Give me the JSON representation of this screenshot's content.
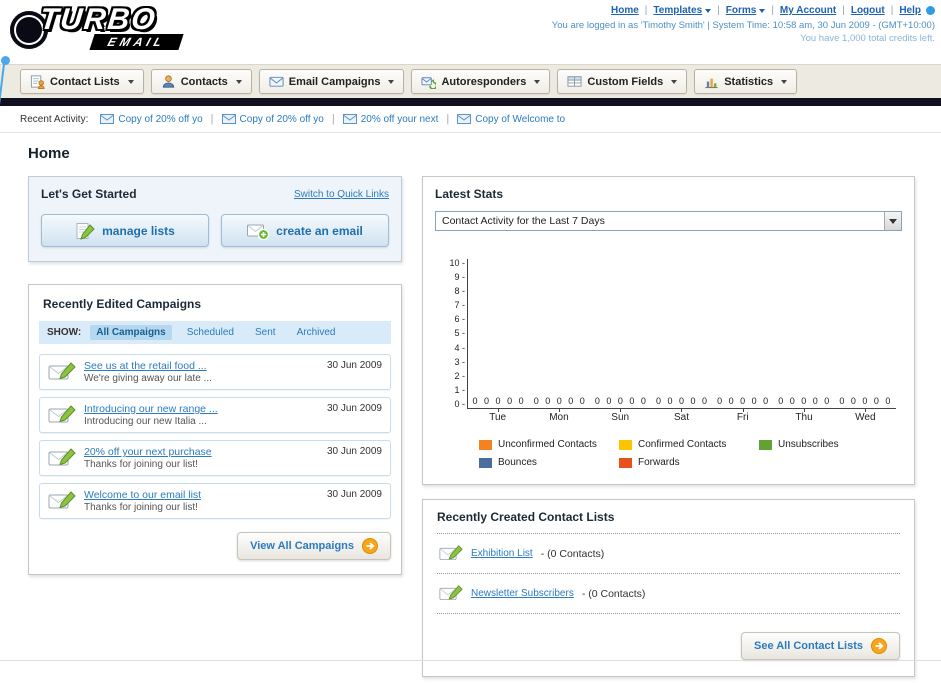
{
  "header": {
    "logo_title": "TURBO",
    "logo_subtitle": "EMAIL",
    "nav": {
      "home": "Home",
      "templates": "Templates",
      "forms": "Forms",
      "my_account": "My Account",
      "logout": "Logout",
      "help": "Help"
    },
    "login_info": "You are logged in as 'Timothy Smith' | System Time: 10:58 am, 30 Jun 2009 - (GMT+10:00)",
    "credits_info": "You have 1,000 total credits left."
  },
  "nav_tabs": [
    {
      "label": "Contact Lists"
    },
    {
      "label": "Contacts"
    },
    {
      "label": "Email Campaigns"
    },
    {
      "label": "Autoresponders"
    },
    {
      "label": "Custom Fields"
    },
    {
      "label": "Statistics"
    }
  ],
  "recent_activity": {
    "label": "Recent Activity:",
    "items": [
      {
        "text": "Copy of 20% off yo"
      },
      {
        "text": "Copy of 20% off yo"
      },
      {
        "text": "20% off your next"
      },
      {
        "text": "Copy of Welcome to"
      }
    ]
  },
  "page": {
    "title": "Home"
  },
  "get_started": {
    "title": "Let's Get Started",
    "switch_link": "Switch to Quick Links",
    "manage_lists_button": "manage lists",
    "create_email_button": "create an email"
  },
  "campaigns": {
    "title": "Recently Edited Campaigns",
    "show_label": "SHOW:",
    "tabs": [
      {
        "label": "All Campaigns"
      },
      {
        "label": "Scheduled"
      },
      {
        "label": "Sent"
      },
      {
        "label": "Archived"
      }
    ],
    "items": [
      {
        "title": "See us at the retail food ...",
        "subtitle": "We're giving away our late ...",
        "date": "30 Jun 2009"
      },
      {
        "title": "Introducing our new range ...",
        "subtitle": "Introducing our new Italia ...",
        "date": "30 Jun 2009"
      },
      {
        "title": "20% off your next purchase",
        "subtitle": "Thanks for joining our list!",
        "date": "30 Jun 2009"
      },
      {
        "title": "Welcome to our email list",
        "subtitle": "Thanks for joining our list!",
        "date": "30 Jun 2009"
      }
    ],
    "view_all_button": "View All Campaigns"
  },
  "stats": {
    "title": "Latest Stats",
    "dropdown_value": "Contact Activity for the Last 7 Days",
    "chart_data": {
      "type": "bar",
      "title": "Contact Activity for the Last 7 Days",
      "categories": [
        "Tue",
        "Mon",
        "Sun",
        "Sat",
        "Fri",
        "Thu",
        "Wed"
      ],
      "series": [
        {
          "name": "Unconfirmed Contacts",
          "color": "#f6821f",
          "values": [
            0,
            0,
            0,
            0,
            0,
            0,
            0
          ]
        },
        {
          "name": "Confirmed Contacts",
          "color": "#fdc400",
          "values": [
            0,
            0,
            0,
            0,
            0,
            0,
            0
          ]
        },
        {
          "name": "Unsubscribes",
          "color": "#61a233",
          "values": [
            0,
            0,
            0,
            0,
            0,
            0,
            0
          ]
        },
        {
          "name": "Bounces",
          "color": "#4a6d9d",
          "values": [
            0,
            0,
            0,
            0,
            0,
            0,
            0
          ]
        },
        {
          "name": "Forwards",
          "color": "#e8511d",
          "values": [
            0,
            0,
            0,
            0,
            0,
            0,
            0
          ]
        }
      ],
      "ylim": [
        0,
        10
      ],
      "xlabel": "",
      "ylabel": "",
      "grid": false,
      "legend_position": "bottom"
    }
  },
  "contact_lists": {
    "title": "Recently Created Contact Lists",
    "items": [
      {
        "name": "Exhibition List",
        "count": "- (0 Contacts)"
      },
      {
        "name": "Newsletter Subscribers",
        "count": "- (0 Contacts)"
      }
    ],
    "see_all_button": "See All Contact Lists"
  }
}
